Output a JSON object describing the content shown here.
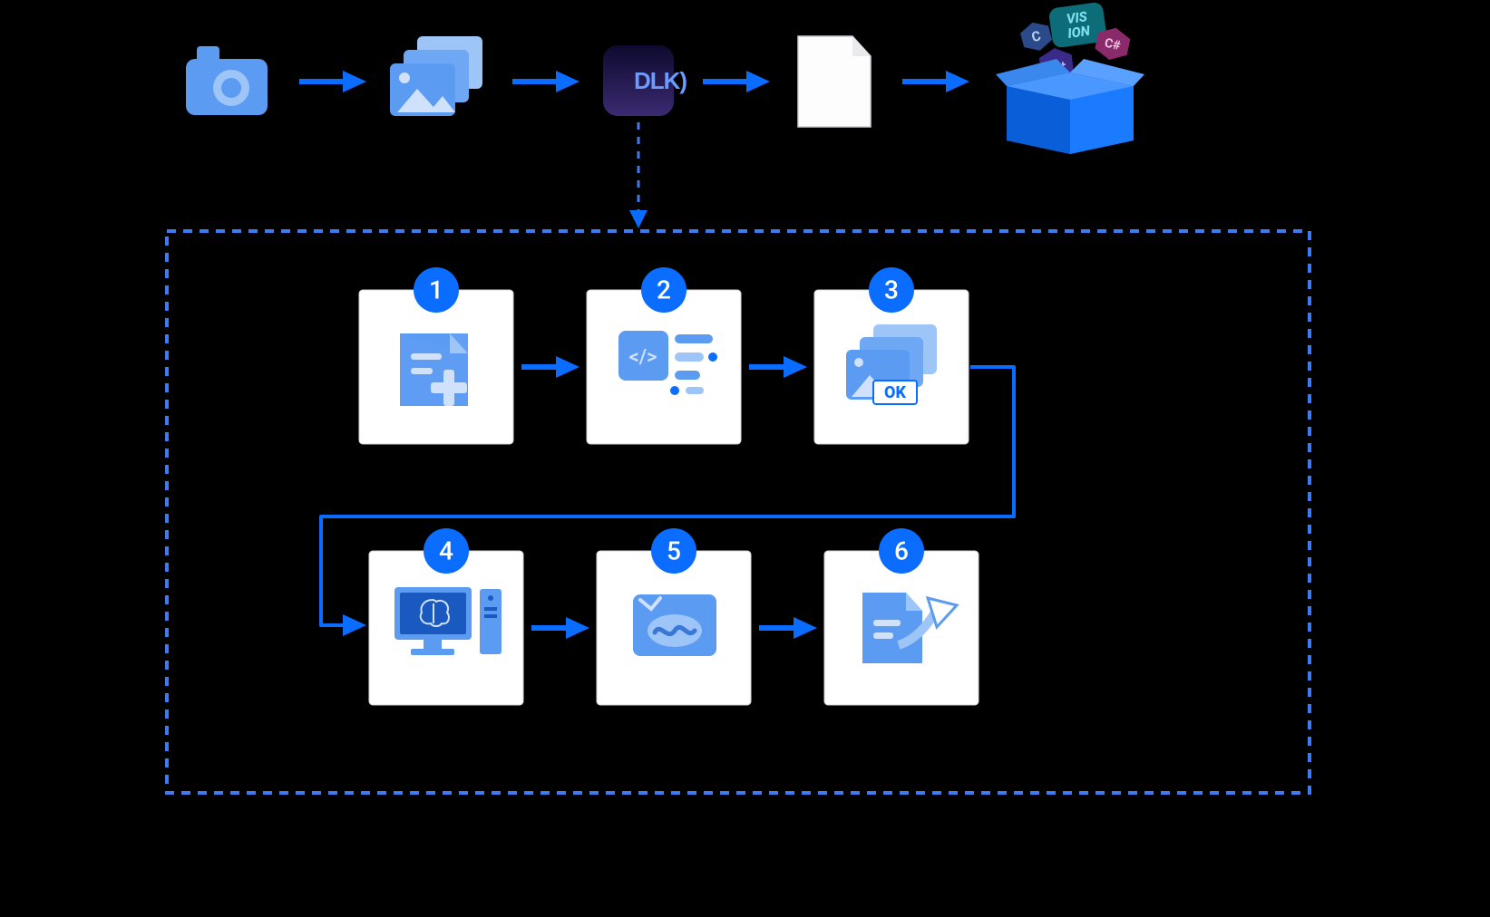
{
  "colors": {
    "accent": "#0a6dff",
    "accent_light": "#5b9bf2",
    "accent_pale": "#9ec5f7",
    "bg": "#000000",
    "card_bg": "#ffffff",
    "card_border": "#d0d4da",
    "dashed_border": "#3d7cf0",
    "dlk_bg_top": "#1a1440",
    "dlk_bg_bottom": "#3a2a7a",
    "dlk_text": "#6a9bff",
    "pill_vision": "#0c6d78",
    "pill_c": "#2a4a8a",
    "pill_cs": "#8a2a6a",
    "pill_cpp": "#3a2a8a"
  },
  "top_pipeline": {
    "items": [
      {
        "id": "camera",
        "icon": "camera-icon"
      },
      {
        "id": "images",
        "icon": "image-stack-icon"
      },
      {
        "id": "dlk",
        "icon": "dlk-app-icon",
        "label": "DLK)"
      },
      {
        "id": "file",
        "icon": "blank-file-icon"
      },
      {
        "id": "sdk_box",
        "icon": "sdk-box-icon",
        "labels": [
          "VIS",
          "ION",
          "C",
          "C#",
          "C++"
        ]
      }
    ]
  },
  "steps": [
    {
      "n": "1",
      "icon": "new-project-icon"
    },
    {
      "n": "2",
      "icon": "code-list-icon"
    },
    {
      "n": "3",
      "icon": "labeled-images-icon",
      "badge_text": "OK"
    },
    {
      "n": "4",
      "icon": "training-computer-icon"
    },
    {
      "n": "5",
      "icon": "verify-signature-icon"
    },
    {
      "n": "6",
      "icon": "export-file-icon"
    }
  ]
}
